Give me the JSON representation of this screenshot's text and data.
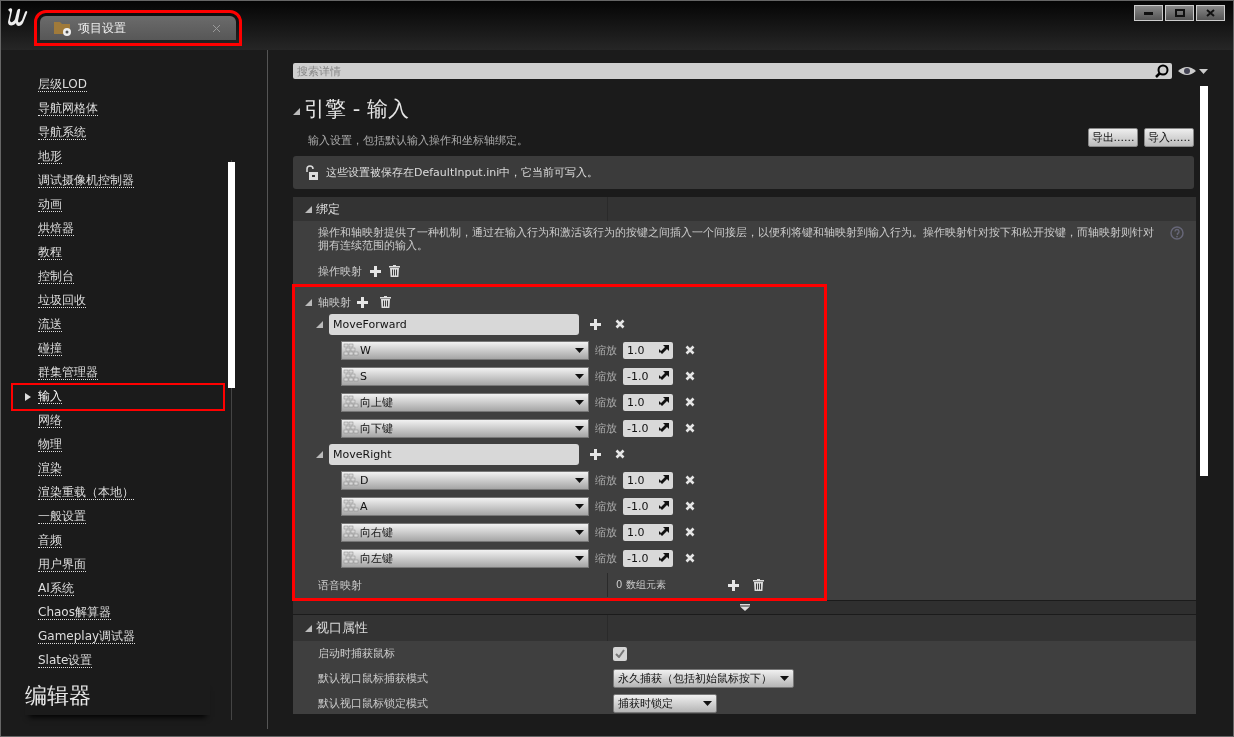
{
  "window": {
    "tab_title": "项目设置",
    "tab_highlighted": true
  },
  "sidebar": {
    "items": [
      {
        "label": "层级LOD",
        "selected": false,
        "highlighted": false
      },
      {
        "label": "导航网格体",
        "selected": false,
        "highlighted": false
      },
      {
        "label": "导航系统",
        "selected": false,
        "highlighted": false
      },
      {
        "label": "地形",
        "selected": false,
        "highlighted": false
      },
      {
        "label": "调试摄像机控制器",
        "selected": false,
        "highlighted": false
      },
      {
        "label": "动画",
        "selected": false,
        "highlighted": false
      },
      {
        "label": "烘焙器",
        "selected": false,
        "highlighted": false
      },
      {
        "label": "教程",
        "selected": false,
        "highlighted": false
      },
      {
        "label": "控制台",
        "selected": false,
        "highlighted": false
      },
      {
        "label": "垃圾回收",
        "selected": false,
        "highlighted": false
      },
      {
        "label": "流送",
        "selected": false,
        "highlighted": false
      },
      {
        "label": "碰撞",
        "selected": false,
        "highlighted": false
      },
      {
        "label": "群集管理器",
        "selected": false,
        "highlighted": false
      },
      {
        "label": "输入",
        "selected": true,
        "highlighted": true
      },
      {
        "label": "网络",
        "selected": false,
        "highlighted": false
      },
      {
        "label": "物理",
        "selected": false,
        "highlighted": false
      },
      {
        "label": "渲染",
        "selected": false,
        "highlighted": false
      },
      {
        "label": "渲染重载（本地）",
        "selected": false,
        "highlighted": false
      },
      {
        "label": "一般设置",
        "selected": false,
        "highlighted": false
      },
      {
        "label": "音频",
        "selected": false,
        "highlighted": false
      },
      {
        "label": "用户界面",
        "selected": false,
        "highlighted": false
      },
      {
        "label": "AI系统",
        "selected": false,
        "highlighted": false
      },
      {
        "label": "Chaos解算器",
        "selected": false,
        "highlighted": false
      },
      {
        "label": "Gameplay调试器",
        "selected": false,
        "highlighted": false
      },
      {
        "label": "Slate设置",
        "selected": false,
        "highlighted": false
      }
    ],
    "section_heading": "编辑器"
  },
  "search": {
    "placeholder": "搜索详情"
  },
  "page": {
    "title": "引擎 - 输入",
    "expanded": true,
    "subtitle": "输入设置，包括默认输入操作和坐标轴绑定。",
    "buttons": [
      "导出......",
      "导入......"
    ]
  },
  "notice": "这些设置被保存在DefaultInput.ini中，它当前可写入。",
  "bindings": {
    "title": "绑定",
    "expanded": true,
    "description": "操作和轴映射提供了一种机制，通过在输入行为和激活该行为的按键之间插入一个间接层，以便利将键和轴映射到输入行为。操作映射针对按下和松开按键，而轴映射则针对拥有连续范围的输入。",
    "action_mappings_label": "操作映射",
    "axis": {
      "label": "轴映射",
      "expanded": true,
      "highlighted": true,
      "mappings": [
        {
          "name": "MoveForward",
          "expanded": true,
          "keys": [
            {
              "key": "W",
              "scale_label": "缩放",
              "scale": "1.0"
            },
            {
              "key": "S",
              "scale_label": "缩放",
              "scale": "-1.0"
            },
            {
              "key": "向上键",
              "scale_label": "缩放",
              "scale": "1.0"
            },
            {
              "key": "向下键",
              "scale_label": "缩放",
              "scale": "-1.0"
            }
          ]
        },
        {
          "name": "MoveRight",
          "expanded": true,
          "keys": [
            {
              "key": "D",
              "scale_label": "缩放",
              "scale": "1.0"
            },
            {
              "key": "A",
              "scale_label": "缩放",
              "scale": "-1.0"
            },
            {
              "key": "向右键",
              "scale_label": "缩放",
              "scale": "1.0"
            },
            {
              "key": "向左键",
              "scale_label": "缩放",
              "scale": "-1.0"
            }
          ]
        }
      ]
    },
    "speech": {
      "label": "语音映射",
      "count": "0 数组元素"
    }
  },
  "viewport": {
    "title": "视口属性",
    "expanded": true,
    "rows": [
      {
        "kind": "checkbox",
        "label": "启动时捕获鼠标",
        "checked": true
      },
      {
        "kind": "dropdown",
        "label": "默认视口鼠标捕获模式",
        "value": "永久捕获（包括初始鼠标按下）"
      },
      {
        "kind": "dropdown",
        "label": "默认视口鼠标锁定模式",
        "value": "捕获时锁定"
      }
    ]
  }
}
